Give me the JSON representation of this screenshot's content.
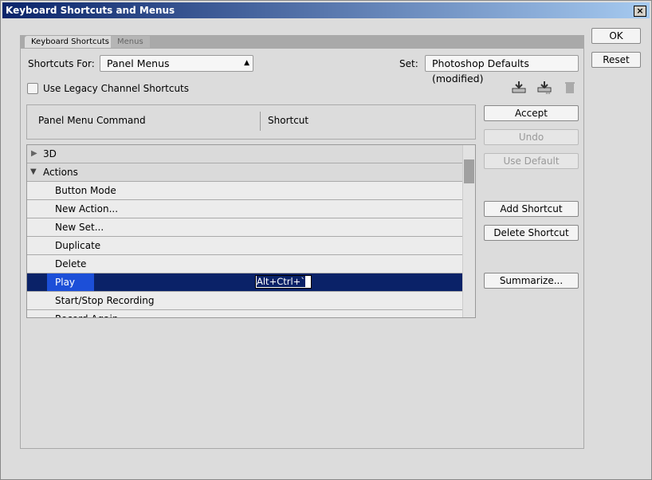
{
  "title": "Keyboard Shortcuts and Menus",
  "close": "×",
  "tabs": [
    "Keyboard Shortcuts",
    "Menus"
  ],
  "shortcuts_for_label": "Shortcuts For:",
  "shortcuts_for_value": "Panel Menus",
  "set_label": "Set:",
  "set_value": "Photoshop Defaults (modified)",
  "legacy_label": "Use Legacy Channel Shortcuts",
  "columns": [
    "Panel Menu Command",
    "Shortcut"
  ],
  "rows": [
    {
      "label": "3D",
      "type": "group",
      "expanded": false
    },
    {
      "label": "Actions",
      "type": "group",
      "expanded": true
    },
    {
      "label": "Button Mode"
    },
    {
      "label": "New Action..."
    },
    {
      "label": "New Set..."
    },
    {
      "label": "Duplicate"
    },
    {
      "label": "Delete"
    },
    {
      "label": "Play",
      "selected": true,
      "shortcut": "Alt+Ctrl+`"
    },
    {
      "label": "Start/Stop Recording"
    },
    {
      "label": "Record Again..."
    }
  ],
  "buttons": {
    "ok": "OK",
    "reset": "Reset",
    "accept": "Accept",
    "undo": "Undo",
    "use_default": "Use Default",
    "add_shortcut": "Add Shortcut",
    "delete_shortcut": "Delete Shortcut",
    "summarize": "Summarize..."
  },
  "icons": [
    "save-set-icon",
    "save-set-as-icon",
    "delete-set-icon"
  ]
}
